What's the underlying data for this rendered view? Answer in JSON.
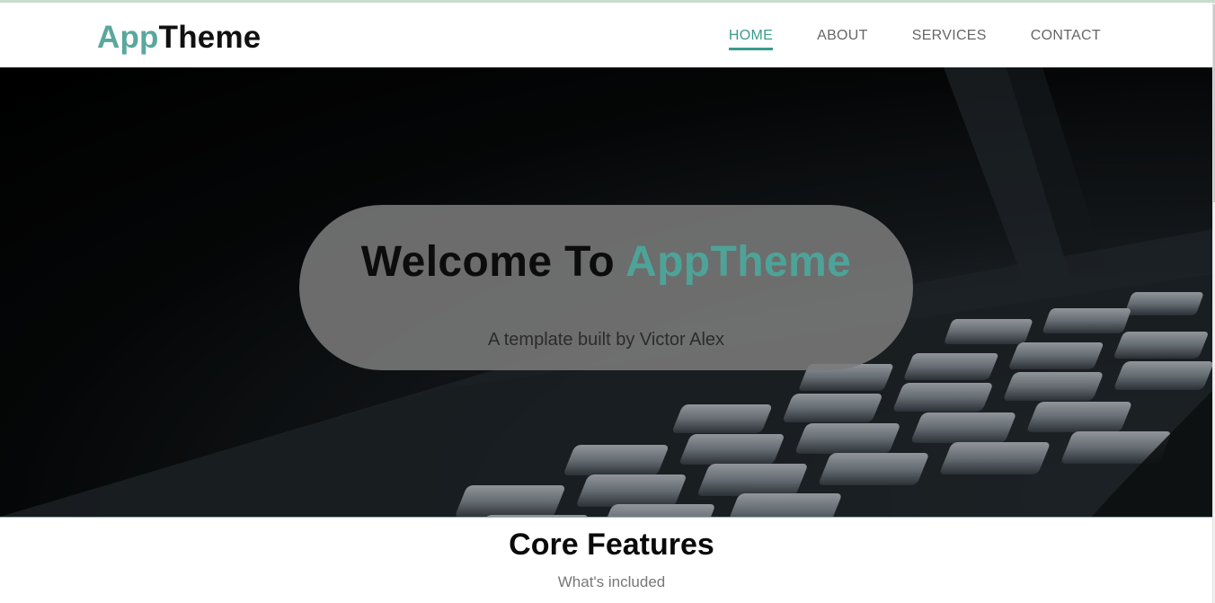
{
  "brand": {
    "part1": "App",
    "part2": "Theme"
  },
  "nav": {
    "items": [
      {
        "label": "HOME",
        "active": true
      },
      {
        "label": "ABOUT",
        "active": false
      },
      {
        "label": "SERVICES",
        "active": false
      },
      {
        "label": "CONTACT",
        "active": false
      }
    ]
  },
  "hero": {
    "title_prefix": "Welcome To ",
    "title_accent": "AppTheme",
    "subtitle": "A template built by Victor Alex"
  },
  "features": {
    "title": "Core Features",
    "subtitle": "What's included"
  },
  "colors": {
    "accent": "#4ea398",
    "nav_active": "#3d9a8f"
  }
}
